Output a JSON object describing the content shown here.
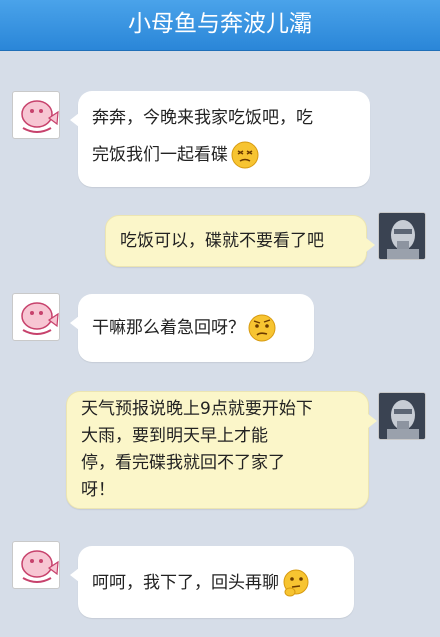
{
  "header": {
    "title": "小母鱼与奔波儿灞"
  },
  "messages": [
    {
      "side": "left",
      "avatar": "pink-fish-avatar",
      "line1": "奔奔，今晚来我家吃饭吧，吃",
      "line2": "完饭我们一起看碟",
      "emoji": "dizzy-face-emoji"
    },
    {
      "side": "right",
      "avatar": "robot-avatar",
      "text": "吃饭可以，碟就不要看了吧"
    },
    {
      "side": "left",
      "avatar": "pink-fish-avatar",
      "text": "干嘛那么着急回呀？",
      "emoji": "confused-face-emoji"
    },
    {
      "side": "right",
      "avatar": "robot-avatar",
      "line1": "天气预报说晚上9点就要开始下",
      "line2": "大雨，要到明天早上才能",
      "line3": "停，看完碟我就回不了家了",
      "line4": "呀！"
    },
    {
      "side": "left",
      "avatar": "pink-fish-avatar",
      "text": "呵呵，我下了，回头再聊",
      "emoji": "thinking-face-emoji"
    }
  ],
  "colors": {
    "titlebar": "#2a86d8",
    "left_bubble": "#ffffff",
    "right_bubble": "#fbf6c9",
    "background": "#d6dde8"
  }
}
